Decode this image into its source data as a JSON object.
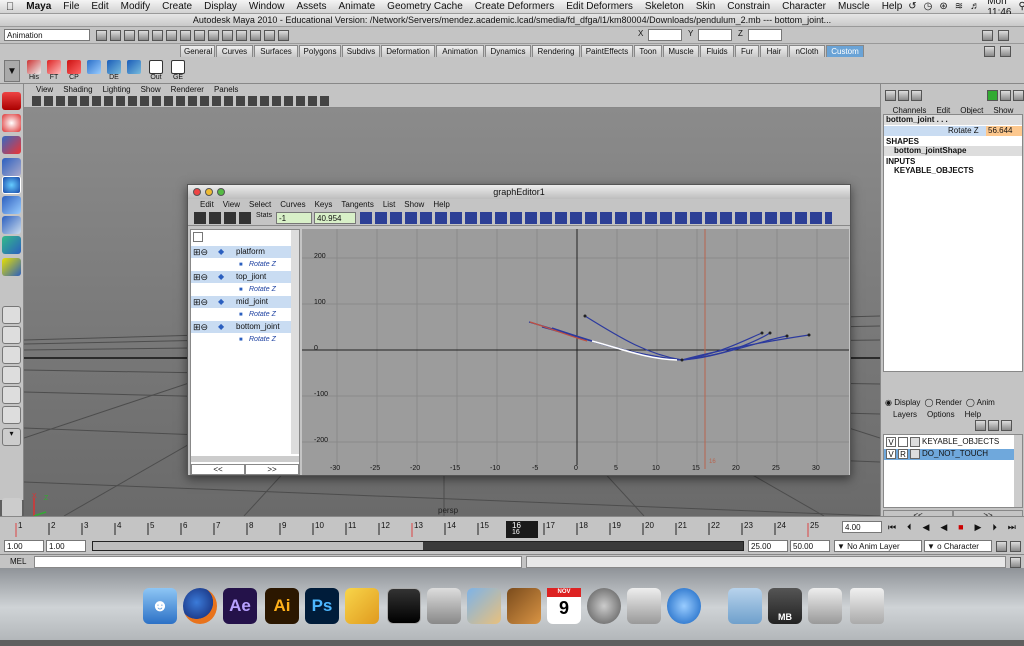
{
  "menubar": {
    "apple": "",
    "app": "Maya",
    "items": [
      "File",
      "Edit",
      "Modify",
      "Create",
      "Display",
      "Window",
      "Assets",
      "Animate",
      "Geometry Cache",
      "Create Deformers",
      "Edit Deformers",
      "Skeleton",
      "Skin",
      "Constrain",
      "Character",
      "Muscle",
      "Help"
    ],
    "clock": "Mon 11:46"
  },
  "window_title": "Autodesk Maya 2010 - Educational Version: /Network/Servers/mendez.academic.lcad/smedia/fd_dfga/l1/km80004/Downloads/pendulum_2.mb  ---  bottom_joint...",
  "status": {
    "mode": "Animation",
    "x_label": "X",
    "y_label": "Y",
    "z_label": "Z"
  },
  "shelf": {
    "tabs": [
      "General",
      "Curves",
      "Surfaces",
      "Polygons",
      "Subdivs",
      "Deformation",
      "Animation",
      "Dynamics",
      "Rendering",
      "PaintEffects",
      "Toon",
      "Muscle",
      "Fluids",
      "Fur",
      "Hair",
      "nCloth",
      "Custom"
    ],
    "active_tab": "Custom",
    "buttons": [
      "His",
      "FT",
      "CP",
      "",
      "DE",
      "",
      "Out",
      "GE"
    ]
  },
  "viewport": {
    "menu": [
      "View",
      "Shading",
      "Lighting",
      "Show",
      "Renderer",
      "Panels"
    ],
    "camera": "persp",
    "axis_x": "X",
    "axis_z": "Z"
  },
  "graph_editor": {
    "title": "graphEditor1",
    "menu": [
      "Edit",
      "View",
      "Select",
      "Curves",
      "Keys",
      "Tangents",
      "List",
      "Show",
      "Help"
    ],
    "stats_label": "Stats",
    "frame_value": "-1",
    "value_field": "40.954",
    "outliner": [
      {
        "name": "platform",
        "attr": "Rotate Z"
      },
      {
        "name": "top_jiont",
        "attr": "Rotate Z"
      },
      {
        "name": "mid_joint",
        "attr": "Rotate Z"
      },
      {
        "name": "bottom_joint",
        "attr": "Rotate Z"
      }
    ],
    "nav_left": "<<",
    "nav_right": ">>",
    "y_ticks": [
      "200",
      "100",
      "0",
      "-100",
      "-200"
    ],
    "x_ticks": [
      "-30",
      "-25",
      "-20",
      "-15",
      "-10",
      "-5",
      "0",
      "5",
      "10",
      "15",
      "20",
      "25",
      "30"
    ],
    "current_frame_label": "16"
  },
  "channel_box": {
    "tabs": [
      "Channels",
      "Edit",
      "Object",
      "Show"
    ],
    "object": "bottom_joint . . .",
    "attr_name": "Rotate Z",
    "attr_value": "56.644",
    "shapes_header": "SHAPES",
    "shape_name": "bottom_jointShape",
    "inputs_header": "INPUTS",
    "input_name": "KEYABLE_OBJECTS",
    "radio": [
      "Display",
      "Render",
      "Anim"
    ],
    "layer_menu": [
      "Layers",
      "Options",
      "Help"
    ],
    "layers": [
      {
        "v": "V",
        "r": "",
        "name": "KEYABLE_OBJECTS"
      },
      {
        "v": "V",
        "r": "R",
        "name": "DO_NOT_TOUCH"
      }
    ],
    "nav_left": "<<",
    "nav_right": ">>"
  },
  "timeline": {
    "ticks": [
      "1",
      "2",
      "3",
      "4",
      "5",
      "6",
      "7",
      "8",
      "9",
      "10",
      "11",
      "12",
      "13",
      "14",
      "15",
      "16",
      "17",
      "18",
      "19",
      "20",
      "21",
      "22",
      "23",
      "24",
      "25"
    ],
    "current": "16",
    "current_sub": "16",
    "current_field": "4.00"
  },
  "range": {
    "start": "1.00",
    "start2": "1.00",
    "end": "25.00",
    "end2": "50.00",
    "anim_layer": "No Anim Layer",
    "char_set": "o Character Set"
  },
  "cmdline": {
    "label": "MEL"
  },
  "dock": {
    "ae": "Ae",
    "ai": "Ai",
    "ps": "Ps",
    "cal_day": "9",
    "cal_month": "NOV",
    "mb": "MB"
  }
}
